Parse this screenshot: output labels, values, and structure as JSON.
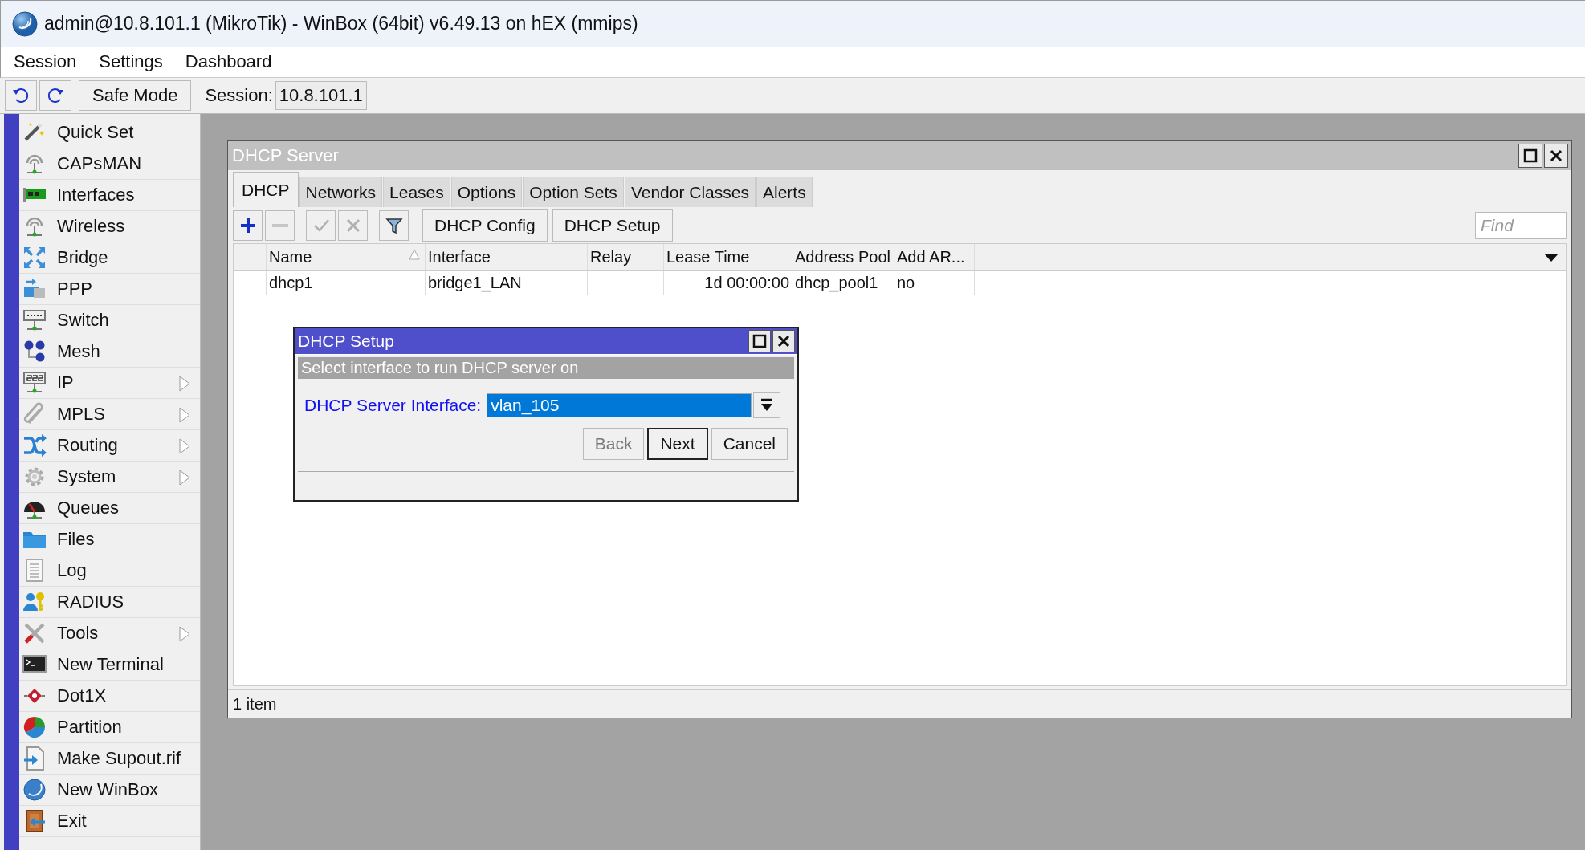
{
  "window": {
    "title": "admin@10.8.101.1 (MikroTik) - WinBox (64bit) v6.49.13 on hEX (mmips)"
  },
  "menu": [
    "Session",
    "Settings",
    "Dashboard"
  ],
  "toolbar": {
    "safe_mode": "Safe Mode",
    "session_label": "Session:",
    "session_value": "10.8.101.1"
  },
  "sidebar": {
    "items": [
      {
        "label": "Quick Set",
        "submenu": false
      },
      {
        "label": "CAPsMAN",
        "submenu": false
      },
      {
        "label": "Interfaces",
        "submenu": false
      },
      {
        "label": "Wireless",
        "submenu": false
      },
      {
        "label": "Bridge",
        "submenu": false
      },
      {
        "label": "PPP",
        "submenu": false
      },
      {
        "label": "Switch",
        "submenu": false
      },
      {
        "label": "Mesh",
        "submenu": false
      },
      {
        "label": "IP",
        "submenu": true
      },
      {
        "label": "MPLS",
        "submenu": true
      },
      {
        "label": "Routing",
        "submenu": true
      },
      {
        "label": "System",
        "submenu": true
      },
      {
        "label": "Queues",
        "submenu": false
      },
      {
        "label": "Files",
        "submenu": false
      },
      {
        "label": "Log",
        "submenu": false
      },
      {
        "label": "RADIUS",
        "submenu": false
      },
      {
        "label": "Tools",
        "submenu": true
      },
      {
        "label": "New Terminal",
        "submenu": false
      },
      {
        "label": "Dot1X",
        "submenu": false
      },
      {
        "label": "Partition",
        "submenu": false
      },
      {
        "label": "Make Supout.rif",
        "submenu": false
      },
      {
        "label": "New WinBox",
        "submenu": false
      },
      {
        "label": "Exit",
        "submenu": false
      }
    ]
  },
  "dhcp_server": {
    "title": "DHCP Server",
    "tabs": [
      {
        "label": "DHCP",
        "selected": true
      },
      {
        "label": "Networks",
        "selected": false
      },
      {
        "label": "Leases",
        "selected": false
      },
      {
        "label": "Options",
        "selected": false
      },
      {
        "label": "Option Sets",
        "selected": false
      },
      {
        "label": "Vendor Classes",
        "selected": false
      },
      {
        "label": "Alerts",
        "selected": false
      }
    ],
    "icon_buttons": [
      {
        "disabled": false
      },
      {
        "disabled": true
      },
      {
        "disabled": true
      },
      {
        "disabled": true
      },
      {
        "disabled": false
      }
    ],
    "buttons": [
      "DHCP Config",
      "DHCP Setup"
    ],
    "find": {
      "placeholder": "Find"
    },
    "table": {
      "columns": [
        {
          "label": "Name",
          "sorted": true
        },
        {
          "label": "Interface",
          "sorted": false
        },
        {
          "label": "Relay",
          "sorted": false
        },
        {
          "label": "Lease Time",
          "sorted": false
        },
        {
          "label": "Address Pool",
          "sorted": false
        },
        {
          "label": "Add AR...",
          "sorted": false
        }
      ],
      "rows": [
        {
          "name": "dhcp1",
          "interface": "bridge1_LAN",
          "lease_time": "1d 00:00:00",
          "address_pool": "dhcp_pool1",
          "add_arp": "no"
        }
      ]
    },
    "status_bar": "1 item"
  },
  "dhcp_setup": {
    "title": "DHCP Setup",
    "subtitle": "Select interface to run DHCP server on",
    "field_label": "DHCP Server Interface:",
    "value": "vlan_105",
    "buttons": [
      {
        "label": "Back",
        "disabled": true,
        "default": false
      },
      {
        "label": "Next",
        "disabled": false,
        "default": true
      },
      {
        "label": "Cancel",
        "disabled": false,
        "default": false
      }
    ]
  }
}
